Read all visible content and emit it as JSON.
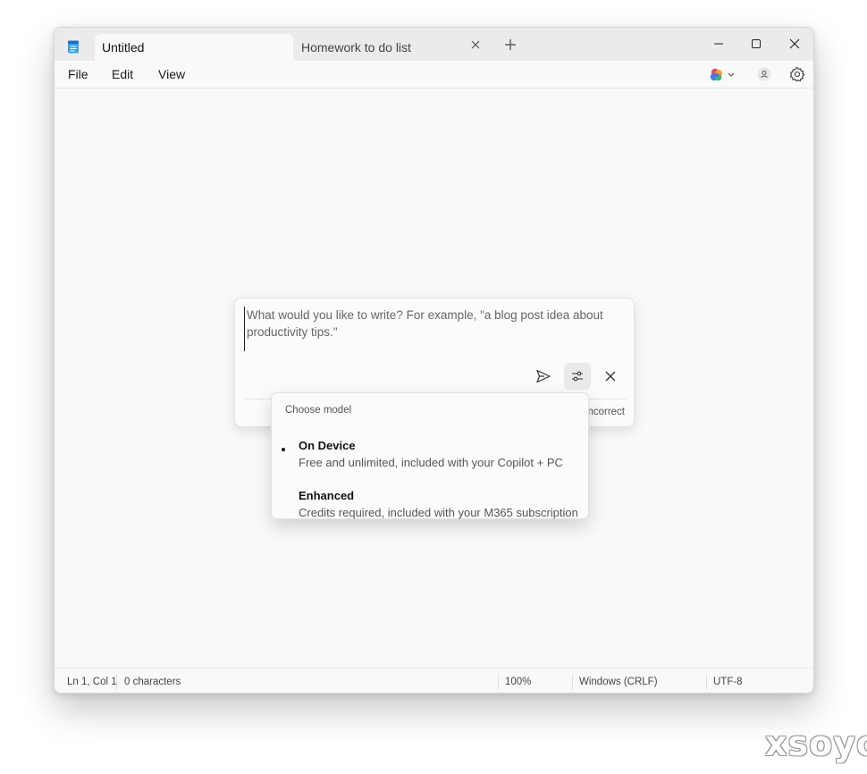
{
  "tabs": [
    {
      "label": "Untitled"
    },
    {
      "label": "Homework to do list"
    }
  ],
  "menu": {
    "file": "File",
    "edit": "Edit",
    "view": "View"
  },
  "prompt": {
    "placeholder": "What would you like to write? For example, \"a blog post idea about productivity tips.\"",
    "footer_text": "ncorrect"
  },
  "model_menu": {
    "header": "Choose model",
    "options": [
      {
        "title": "On Device",
        "description": "Free and unlimited, included with your Copilot + PC",
        "selected": true
      },
      {
        "title": "Enhanced",
        "description": "Credits required, included with your M365 subscription",
        "selected": false
      }
    ]
  },
  "status": {
    "position": "Ln 1, Col 1",
    "characters": "0 characters",
    "zoom": "100%",
    "line_ending": "Windows (CRLF)",
    "encoding": "UTF-8"
  },
  "icons": {
    "app": "notepad-icon",
    "copilot": "copilot-icon",
    "account": "account-icon",
    "settings": "gear-icon"
  },
  "colors": {
    "titlebar": "#ebebeb",
    "canvas": "#f9f9f9"
  },
  "watermark": "xsoyo"
}
